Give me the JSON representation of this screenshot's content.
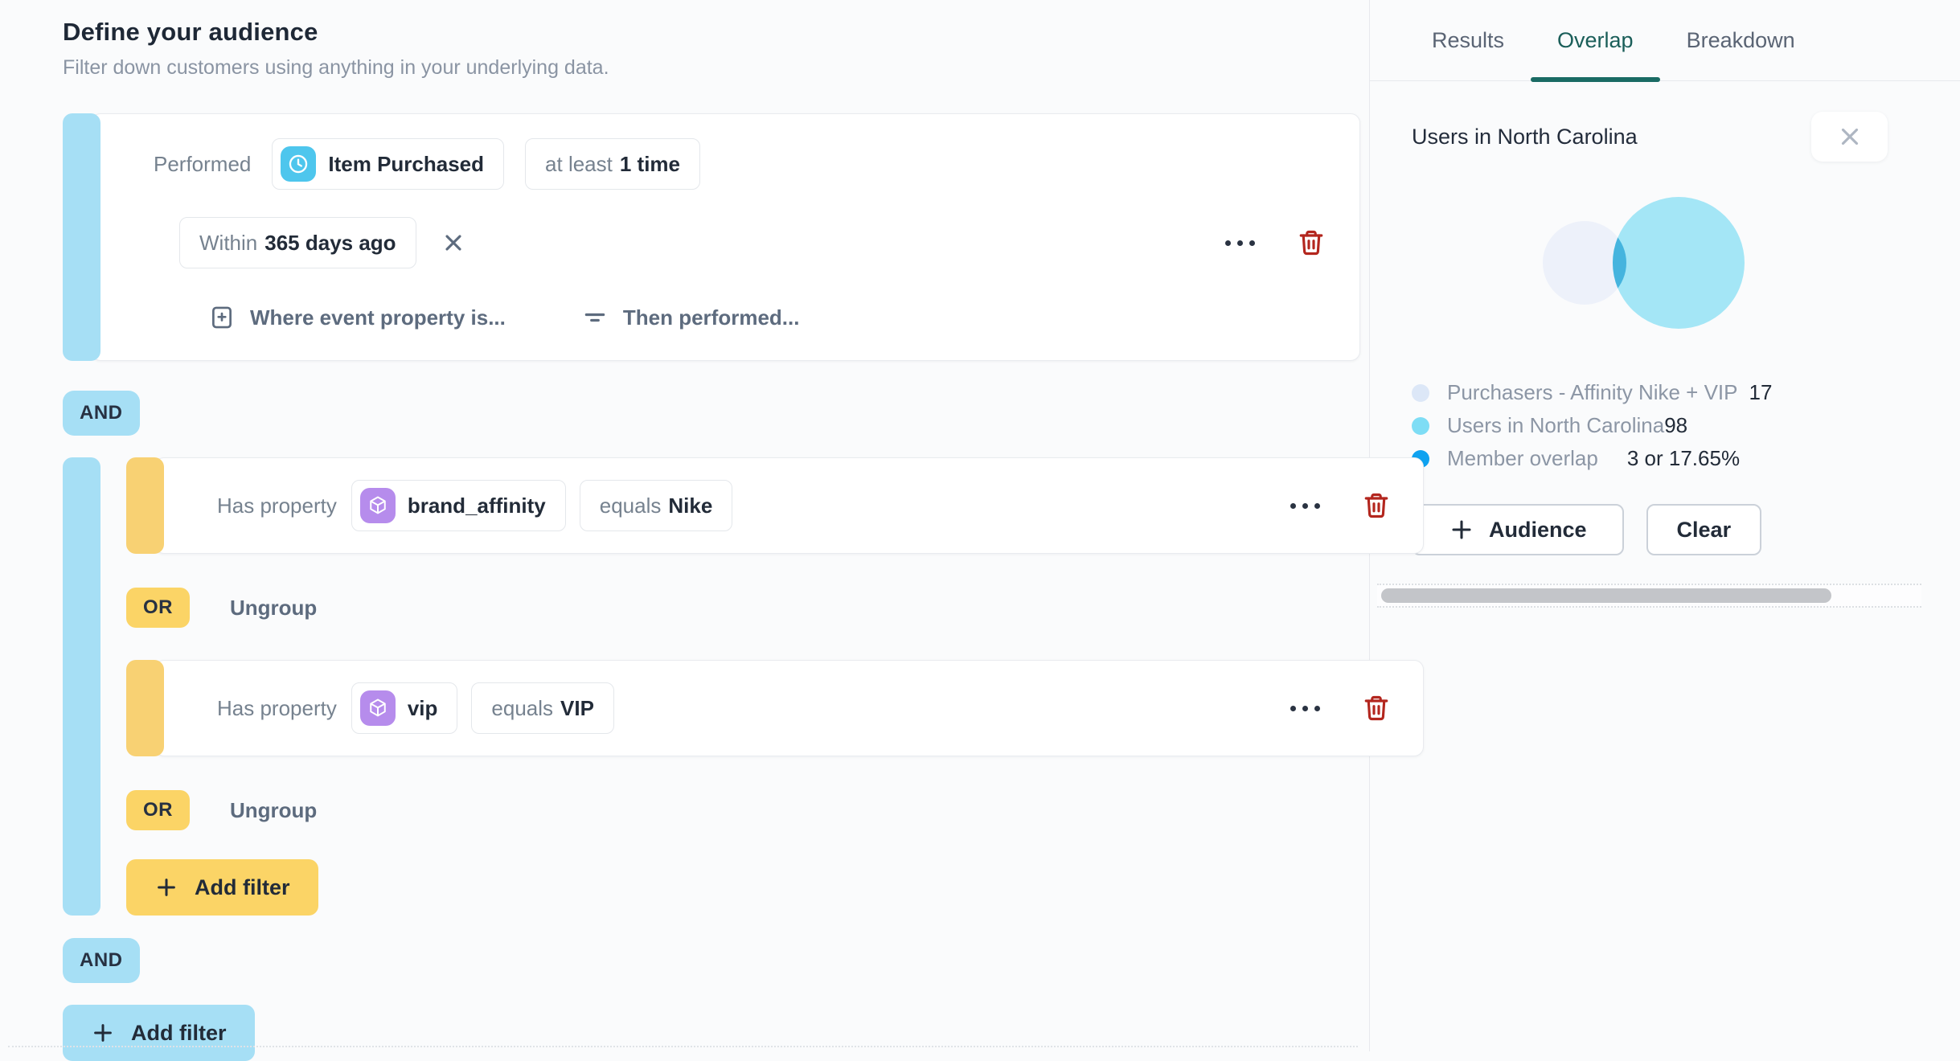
{
  "header": {
    "title": "Define your audience",
    "subtitle": "Filter down customers using anything in your underlying data."
  },
  "group1": {
    "performed_label": "Performed",
    "event_chip": {
      "icon": "clock-icon",
      "label": "Item Purchased"
    },
    "count_chip": {
      "prefix": "at least",
      "value": "1 time"
    },
    "window_chip": {
      "prefix": "Within",
      "value": "365 days ago"
    },
    "where_event_property": "Where event property is...",
    "then_performed": "Then performed..."
  },
  "operators": {
    "and": "AND",
    "or": "OR",
    "ungroup": "Ungroup"
  },
  "group2": {
    "filters": [
      {
        "label": "Has property",
        "icon": "cube-icon",
        "property": "brand_affinity",
        "operator": "equals",
        "value": "Nike"
      },
      {
        "label": "Has property",
        "icon": "cube-icon",
        "property": "vip",
        "operator": "equals",
        "value": "VIP"
      }
    ],
    "add_filter": "Add filter"
  },
  "root_add_filter": "Add filter",
  "panel": {
    "tabs": [
      {
        "label": "Results"
      },
      {
        "label": "Overlap"
      },
      {
        "label": "Breakdown"
      }
    ],
    "active_tab": "Overlap",
    "heading": "Users in North Carolina",
    "venn": {
      "type": "venn",
      "set_a": {
        "label": "Purchasers - Affinity Nike + VIP",
        "size": 17
      },
      "set_b": {
        "label": "Users in North Carolina",
        "size": 98
      },
      "overlap": {
        "label": "Member overlap",
        "size": 3,
        "percent": "17.65%"
      }
    },
    "legend": [
      {
        "label": "Purchasers - Affinity Nike + VIP",
        "value": "17",
        "color": "#DCE7F7"
      },
      {
        "label": "Users in North Carolina",
        "value": "98",
        "color": "#7EDDF5"
      },
      {
        "label": "Member overlap",
        "value": "3 or 17.65%",
        "color": "#0FA2F0"
      }
    ],
    "audience_button": "Audience",
    "clear_button": "Clear"
  },
  "colors": {
    "accent_blue": "#A6DFF5",
    "accent_yellow": "#FBD466",
    "icon_blue": "#4EC6ED",
    "icon_purple": "#B68CEC",
    "danger_red": "#B3261E",
    "tab_active_teal": "#1A6B64",
    "venn_a": "#EDF1FA",
    "venn_b": "#A4E6F6",
    "venn_overlap": "#45B4DE"
  }
}
